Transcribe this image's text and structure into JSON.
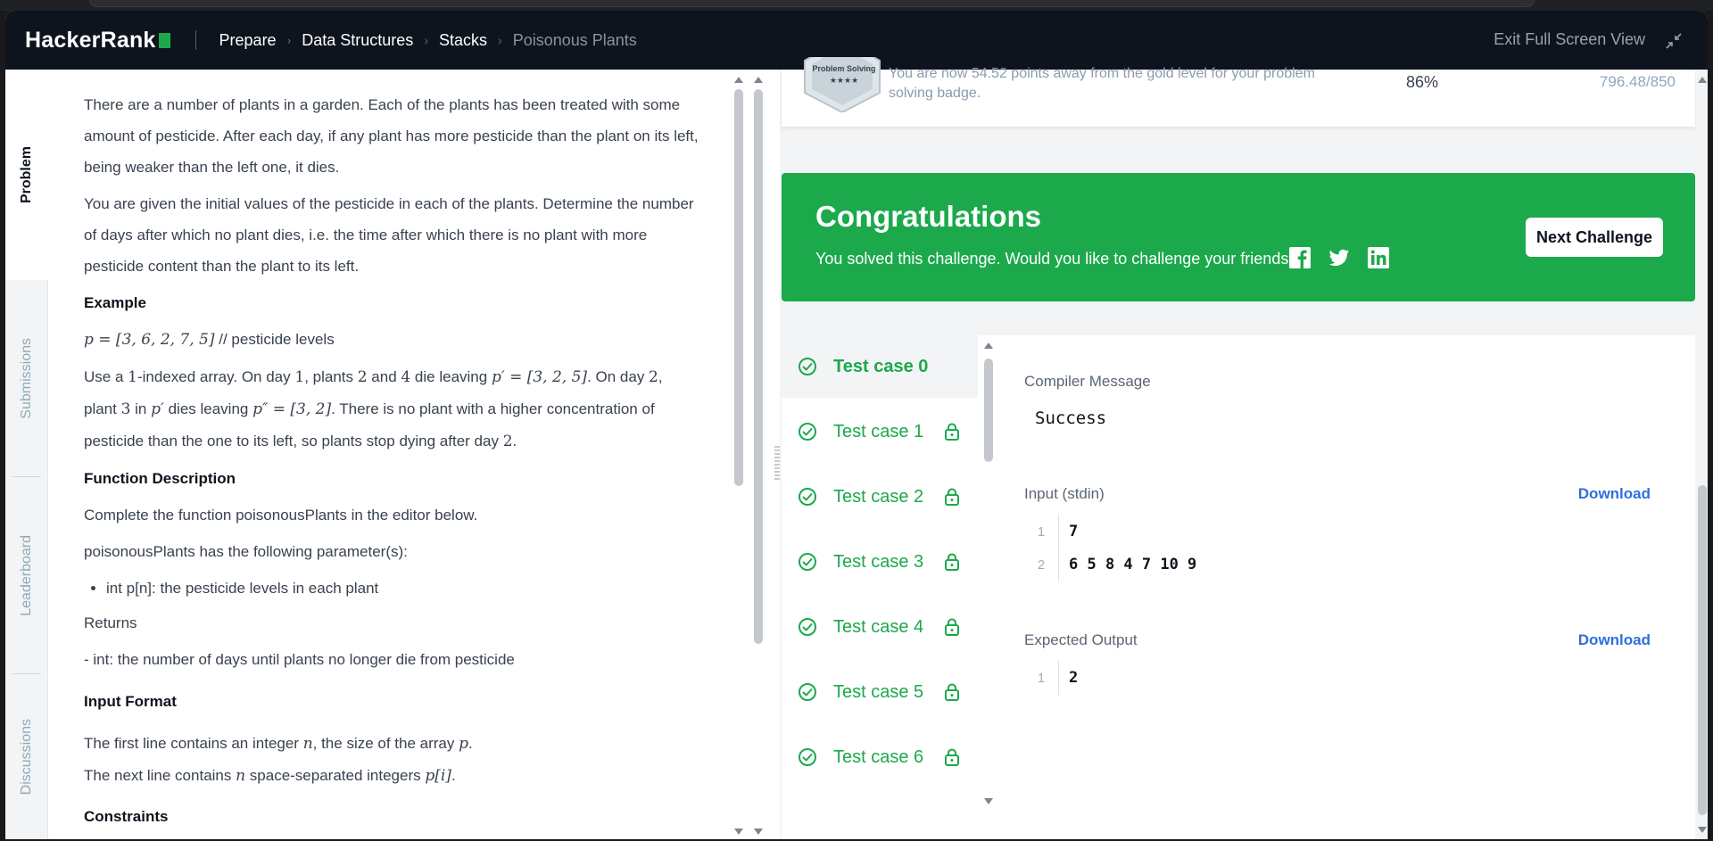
{
  "header": {
    "logo_text": "HackerRank",
    "breadcrumbs": [
      "Prepare",
      "Data Structures",
      "Stacks",
      "Poisonous Plants"
    ],
    "exit_label": "Exit Full Screen View"
  },
  "sidetabs": {
    "problem": "Problem",
    "submissions": "Submissions",
    "leaderboard": "Leaderboard",
    "discussions": "Discussions"
  },
  "problem": {
    "intro": "There are a number of plants in a garden. Each of the plants has been treated with some amount of pesticide. After each day, if any plant has more pesticide than the plant on its left, being weaker than the left one, it dies.",
    "task": "You are given the initial values of the pesticide in each of the plants. Determine the number of days after which no plant dies, i.e. the time after which there is no plant with more pesticide content than the plant to its left.",
    "example_heading": "Example",
    "example_p": "p = [3, 6, 2, 7, 5]",
    "example_comment": " // pesticide levels",
    "ex_a": "Use a ",
    "ex_one": "1",
    "ex_b": "-indexed array. On day ",
    "ex_day1": "1",
    "ex_c": ", plants ",
    "ex_2": "2",
    "ex_d": " and ",
    "ex_4": "4",
    "ex_e": " die leaving ",
    "ex_p1": "p′ = [3, 2, 5]",
    "ex_f": ". On day ",
    "ex_day2": "2",
    "ex_g": ", plant ",
    "ex_3": "3",
    "ex_h": " in ",
    "ex_p1b": "p′",
    "ex_i": " dies leaving ",
    "ex_p2": "p″ = [3, 2]",
    "ex_j": ". There is no plant with a higher concentration of pesticide than the one to its left, so plants stop dying after day ",
    "ex_day2b": "2",
    "ex_k": ".",
    "fd_heading": "Function Description",
    "fd_text": "Complete the function poisonousPlants in the editor below.",
    "params_text": "poisonousPlants has the following parameter(s):",
    "param_1": "int p[n]: the pesticide levels in each plant",
    "returns_label": "Returns",
    "returns_text": "- int: the number of days until plants no longer die from pesticide",
    "if_heading": "Input Format",
    "if_line1_a": "The first line contains an integer ",
    "if_n": "n",
    "if_line1_b": ", the size of the array ",
    "if_p": "p",
    "if_line1_c": ".",
    "if_line2_a": "The next line contains ",
    "if_n2": "n",
    "if_line2_b": " space-separated integers ",
    "if_pi": "p[i]",
    "if_line2_c": ".",
    "constraints_heading": "Constraints"
  },
  "result": {
    "badge_title": "Problem Solving",
    "badge_stars": "★★★★",
    "badge_text": "You are now 54.52 points away from the gold level for your problem solving badge.",
    "percent": "86%",
    "score": "796.48/850",
    "congrats_title": "Congratulations",
    "congrats_text": "You solved this challenge. Would you like to challenge your friends?",
    "next_button": "Next Challenge"
  },
  "tests": {
    "items": [
      "Test case 0",
      "Test case 1",
      "Test case 2",
      "Test case 3",
      "Test case 4",
      "Test case 5",
      "Test case 6"
    ],
    "compiler_label": "Compiler Message",
    "compiler_msg": "Success",
    "input_label": "Input (stdin)",
    "download": "Download",
    "input_lines": [
      {
        "num": "1",
        "text": "7"
      },
      {
        "num": "2",
        "text": "6 5 8 4 7 10 9"
      }
    ],
    "expected_label": "Expected Output",
    "expected_lines": [
      {
        "num": "1",
        "text": "2"
      }
    ]
  },
  "colors": {
    "accent_green": "#1ba94c",
    "header_bg": "#0e141e",
    "link_blue": "#2f6fdf"
  }
}
